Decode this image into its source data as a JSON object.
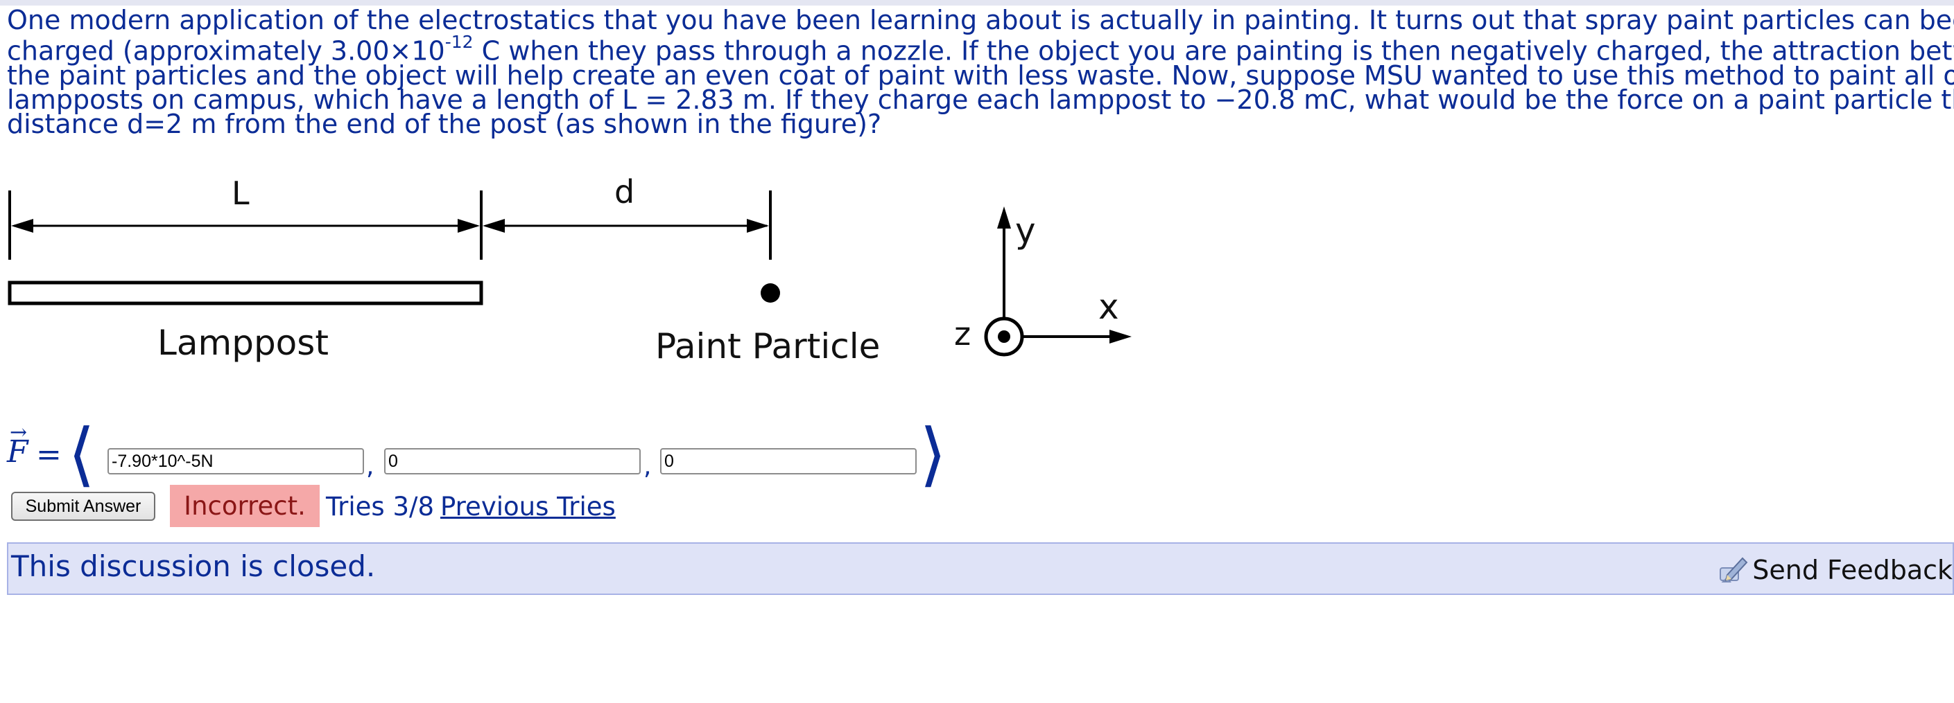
{
  "problem": {
    "line1": "One modern application of the electrostatics that you have been learning about is actually in painting. It turns out that spray paint particles can become",
    "line2_pre": "charged (approximately 3.00×10",
    "line2_sup": "-12",
    "line2_post": " C when they pass through a nozzle. If the object you are painting is then negatively charged, the attraction between",
    "line3": "the paint particles and the object will help create an even coat of paint with less waste. Now, suppose MSU wanted to use this method to paint all of the",
    "line4": "lampposts on campus, which have a length of L = 2.83 m. If they charge each lamppost to −20.8 mC, what would be the force on a paint particle that is a",
    "line5": "distance d=2 m from the end of the post (as shown in the figure)?"
  },
  "figure": {
    "label_L": "L",
    "label_d": "d",
    "label_lamppost": "Lamppost",
    "label_particle": "Paint Particle",
    "axis_y": "y",
    "axis_x": "x",
    "axis_z": "z"
  },
  "answer": {
    "vector_symbol": "F",
    "arrow": "→",
    "equals": "=",
    "open_bracket": "⟨",
    "close_bracket": "⟩",
    "comma": ",",
    "fx_value": "-7.90*10^-5N",
    "fy_value": "0",
    "fz_value": "0"
  },
  "submit": {
    "button_label": "Submit Answer",
    "status": "Incorrect.",
    "tries": "Tries 3/8",
    "previous_tries": "Previous Tries"
  },
  "discussion": {
    "text": "This discussion is closed.",
    "feedback_label": "Send Feedback",
    "feedback_icon": "pencil-feedback-icon"
  },
  "colors": {
    "text_blue": "#0b2c96",
    "incorrect_bg": "#f5a8a8",
    "incorrect_text": "#8a1616",
    "discussion_bg": "#dfe3f7"
  }
}
